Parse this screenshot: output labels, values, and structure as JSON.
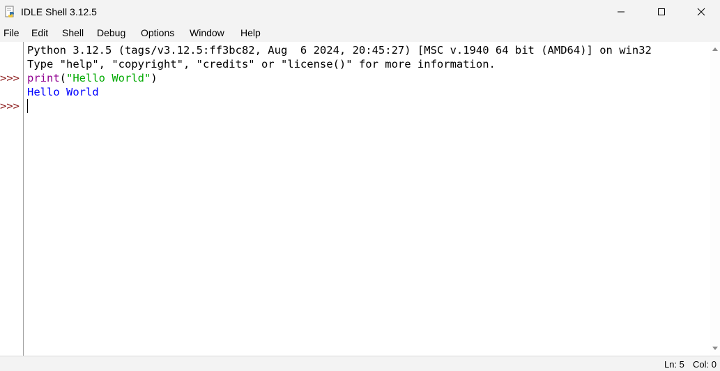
{
  "window": {
    "title": "IDLE Shell 3.12.5",
    "app_icon": "idle-python-icon",
    "controls": {
      "minimize_icon": "minimize-icon",
      "maximize_icon": "maximize-icon",
      "close_icon": "close-icon"
    }
  },
  "menu": {
    "items": [
      "File",
      "Edit",
      "Shell",
      "Debug",
      "Options",
      "Window",
      "Help"
    ]
  },
  "shell": {
    "prompt": ">>>",
    "banner_line1": "Python 3.12.5 (tags/v3.12.5:ff3bc82, Aug  6 2024, 20:45:27) [MSC v.1940 64 bit (AMD64)] on win32",
    "banner_line2": "Type \"help\", \"copyright\", \"credits\" or \"license()\" for more information.",
    "command": {
      "builtin": "print",
      "open_paren": "(",
      "string": "\"Hello World\"",
      "close_paren": ")"
    },
    "output": "Hello World"
  },
  "status": {
    "line": "Ln: 5",
    "col": "Col: 0"
  },
  "colors": {
    "prompt": "#8b1a1a",
    "builtin": "#900090",
    "string": "#00aa00",
    "stdout": "#0000ff"
  }
}
